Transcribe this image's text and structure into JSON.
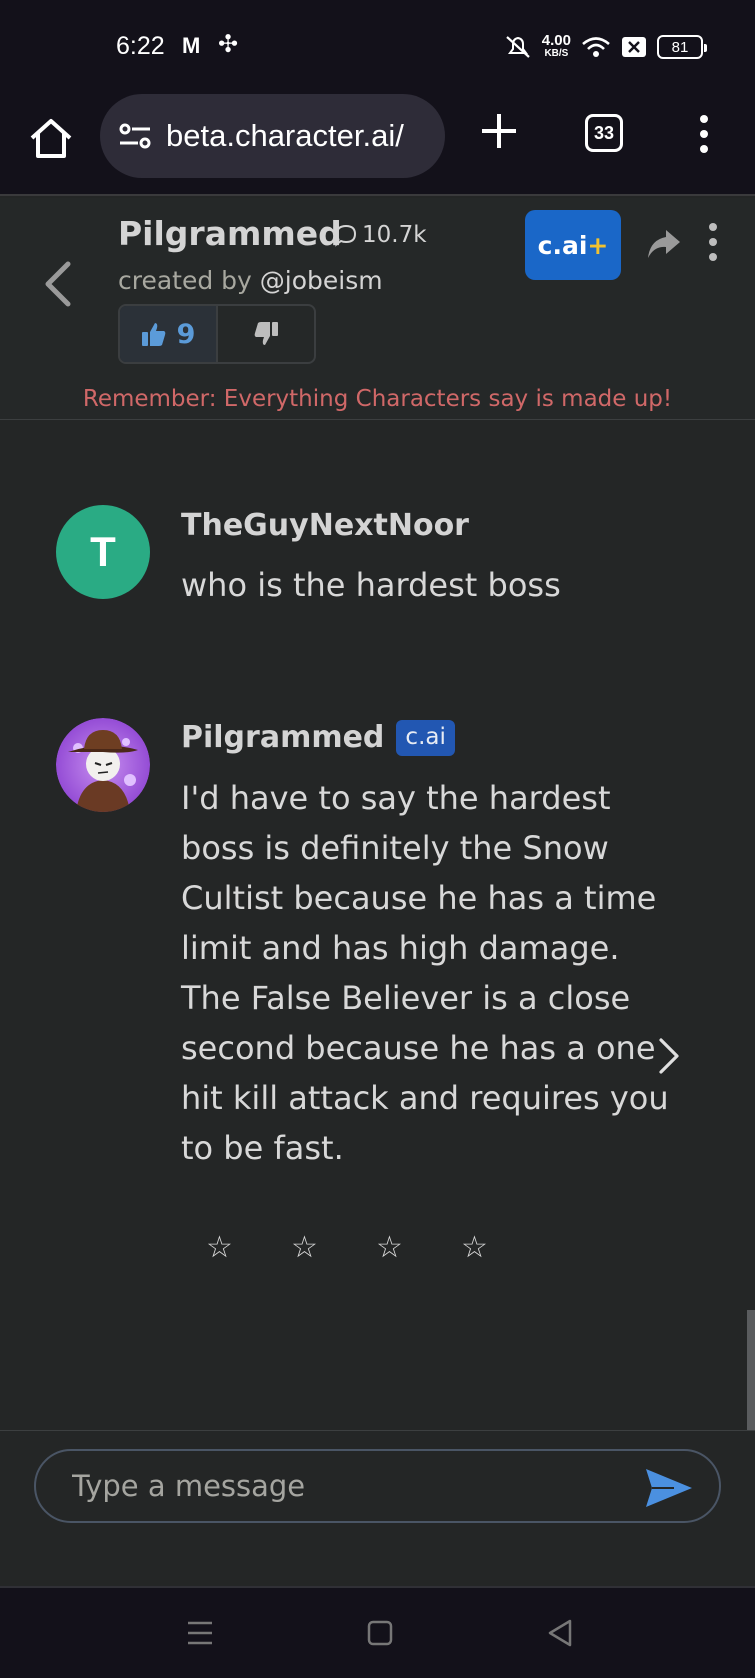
{
  "status_bar": {
    "time": "6:22",
    "gmail": "M",
    "speed_value": "4.00",
    "speed_unit": "KB/S",
    "battery": "81"
  },
  "browser": {
    "url": "beta.character.ai/",
    "tab_count": "33"
  },
  "chat_header": {
    "character_name": "Pilgrammed",
    "chat_count": "10.7k",
    "created_by_label": "created by",
    "creator_handle": "@jobeism",
    "upvotes": "9",
    "plus_label": "c.ai",
    "plus_sign": "+",
    "disclaimer": "Remember: Everything Characters say is made up!"
  },
  "messages": [
    {
      "author": "TheGuyNextNoor",
      "avatar_letter": "T",
      "text": "who is the hardest boss"
    },
    {
      "author": "Pilgrammed",
      "badge": "c.ai",
      "text": "I'd have to say the hardest boss is definitely the Snow Cultist because he has a time limit and has high damage. The False Believer is a close second because he has a one hit kill attack and requires you to be fast."
    }
  ],
  "rating": {
    "stars": [
      "☆",
      "☆",
      "☆",
      "☆"
    ]
  },
  "composer": {
    "placeholder": "Type a message"
  },
  "colors": {
    "accent_blue": "#1a67c8",
    "disclaimer_red": "#d06868",
    "avatar_green": "#2aab84"
  }
}
